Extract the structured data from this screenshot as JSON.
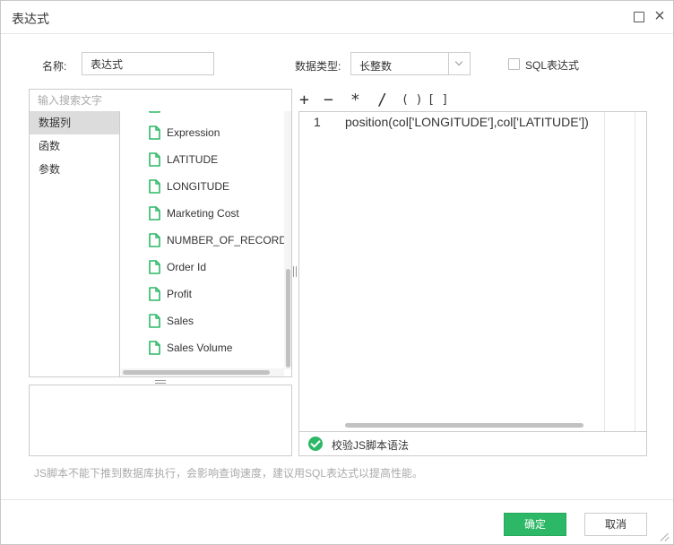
{
  "window": {
    "title": "表达式"
  },
  "form": {
    "name_label": "名称:",
    "name_value": "表达式",
    "type_label": "数据类型:",
    "type_value": "长整数",
    "sql_label": "SQL表达式"
  },
  "search": {
    "placeholder": "输入搜索文字"
  },
  "categories": [
    {
      "label": "数据列",
      "active": true
    },
    {
      "label": "函数",
      "active": false
    },
    {
      "label": "参数",
      "active": false
    }
  ],
  "fields": [
    "",
    "Expression",
    "LATITUDE",
    "LONGITUDE",
    "Marketing Cost",
    "NUMBER_OF_RECORDS",
    "Order Id",
    "Profit",
    "Sales",
    "Sales Volume"
  ],
  "operators": [
    "+",
    "−",
    "*",
    "/",
    "( )",
    "[ ]"
  ],
  "editor": {
    "line_number": "1",
    "code": "position(col['LONGITUDE'],col['LATITUDE'])"
  },
  "validate": {
    "label": "校验JS脚本语法"
  },
  "hint": "JS脚本不能下推到数据库执行，会影响查询速度，建议用SQL表达式以提高性能。",
  "footer": {
    "ok": "确定",
    "cancel": "取消"
  },
  "colors": {
    "accent": "#2cb866",
    "file_icon": "#2cb866"
  },
  "icons": {
    "field": "file-icon",
    "validate": "check-circle-icon",
    "maximize": "maximize-icon",
    "close": "close-icon"
  }
}
